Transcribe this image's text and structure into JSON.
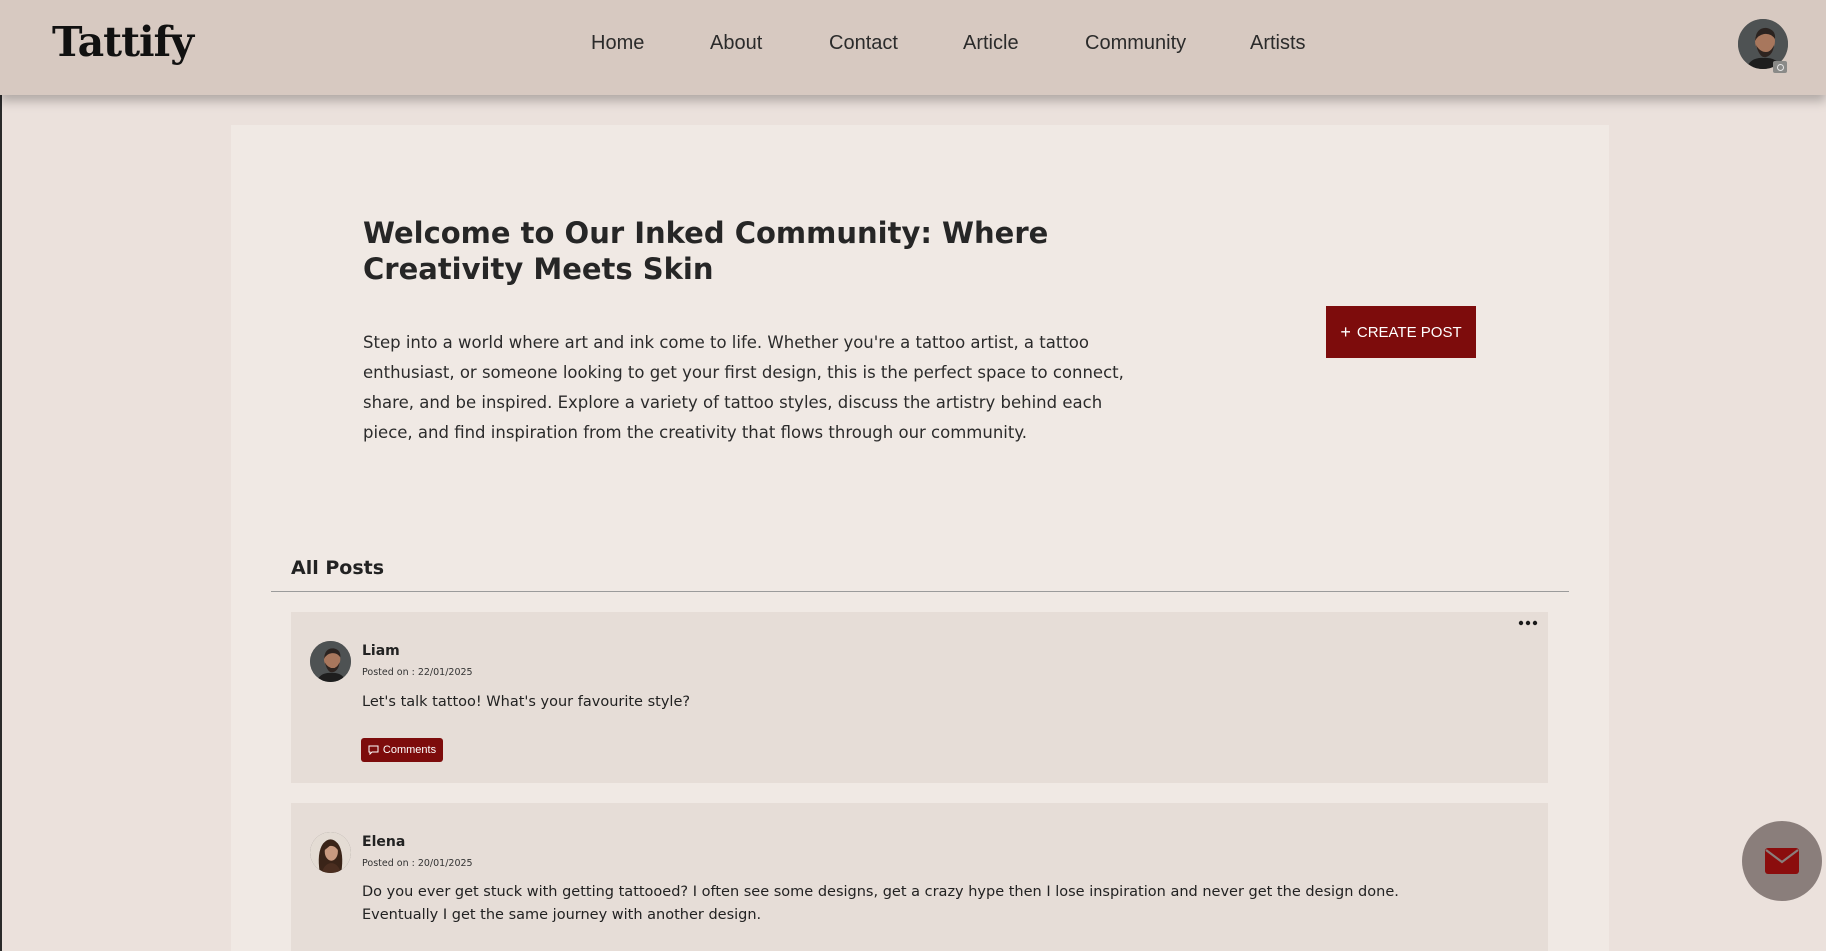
{
  "header": {
    "logo": "Tattify",
    "nav": [
      {
        "label": "Home"
      },
      {
        "label": "About"
      },
      {
        "label": "Contact"
      },
      {
        "label": "Article"
      },
      {
        "label": "Community"
      },
      {
        "label": "Artists"
      }
    ],
    "avatar_icon": "profile-avatar",
    "camera_icon": "camera-icon"
  },
  "hero": {
    "title": "Welcome to Our Inked Community: Where Creativity Meets Skin",
    "text": "Step into a world where art and ink come to life. Whether you're a tattoo artist, a tattoo enthusiast, or someone looking to get your first design, this is the perfect space to connect, share, and be inspired. Explore a variety of tattoo styles, discuss the artistry behind each piece, and find inspiration from the creativity that flows through our community.",
    "create_button": "CREATE POST",
    "create_icon": "+"
  },
  "posts_section": {
    "title": "All Posts",
    "posts": [
      {
        "author": "Liam",
        "date": "Posted on : 22/01/2025",
        "body": "Let's talk tattoo! What's your favourite style?",
        "comments_label": "Comments"
      },
      {
        "author": "Elena",
        "date": "Posted on : 20/01/2025",
        "body": "Do you ever get stuck with getting tattooed? I often see some designs, get a crazy hype then I lose inspiration and never get the design done. Eventually I get the same journey with another design."
      }
    ]
  },
  "colors": {
    "accent": "#7d0c0c",
    "header_bg": "#d7c9c1",
    "panel_bg": "#f0e9e4",
    "post_bg": "#e6ddd7"
  },
  "fab": {
    "icon": "mail-icon"
  }
}
